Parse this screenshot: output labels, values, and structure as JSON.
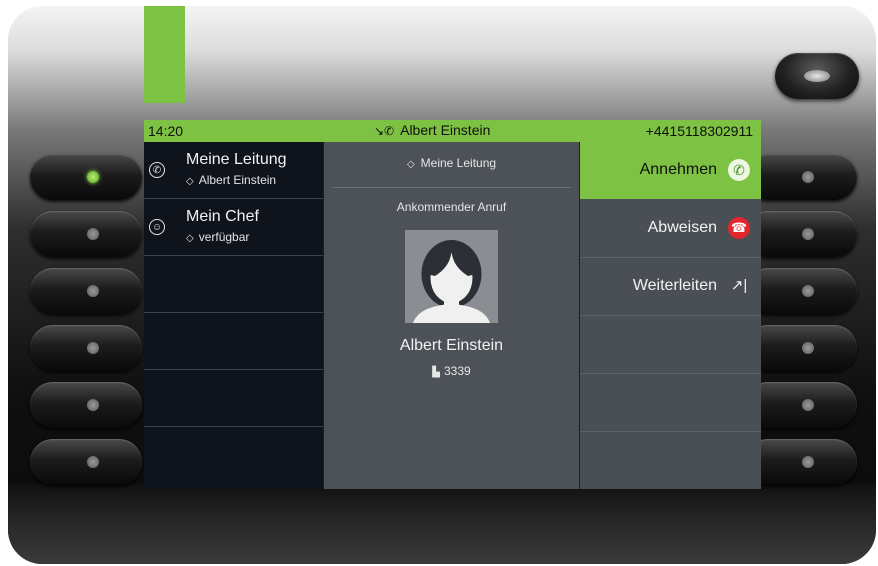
{
  "status_bar": {
    "time": "14:20",
    "caller_name": "Albert Einstein",
    "number": "+4415118302911"
  },
  "lines": [
    {
      "name": "Meine Leitung",
      "sub": "Albert Einstein",
      "icon": "phone-line-icon"
    },
    {
      "name": "Mein Chef",
      "sub": "verfügbar",
      "icon": "person-line-icon"
    }
  ],
  "call": {
    "line_label": "Meine Leitung",
    "state": "Ankommender Anruf",
    "caller_name": "Albert Einstein",
    "extension": "3339"
  },
  "actions": {
    "answer": "Annehmen",
    "reject": "Abweisen",
    "forward": "Weiterleiten"
  },
  "colors": {
    "accent_green": "#7dc242",
    "reject_red": "#e2262b"
  }
}
